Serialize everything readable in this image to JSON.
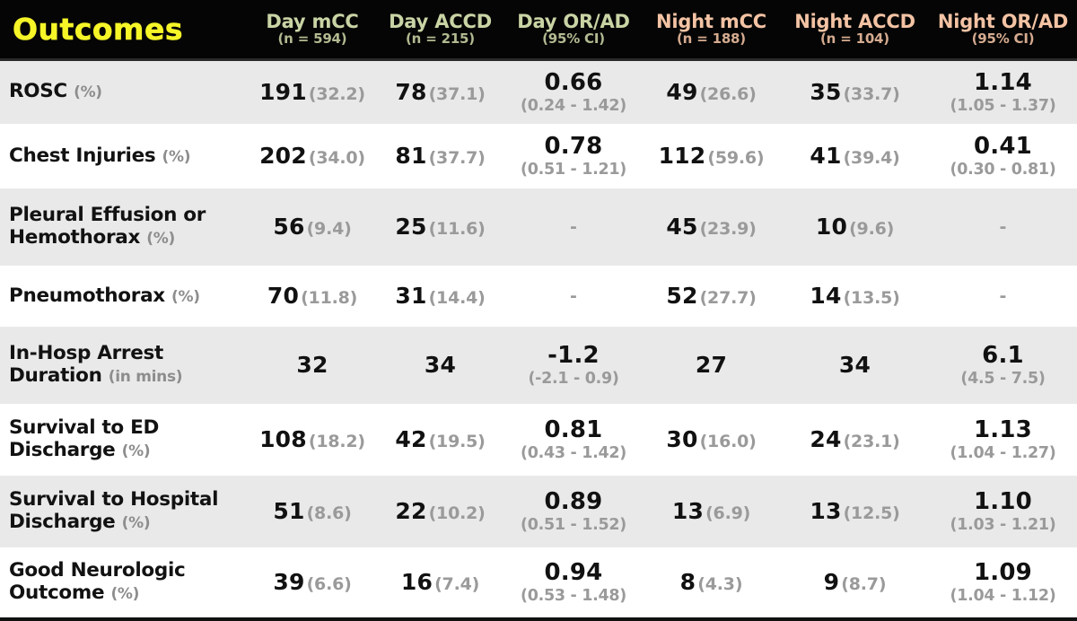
{
  "table": {
    "columns": [
      {
        "key": "outcome",
        "title": "Outcomes",
        "subtitle": "",
        "group": "title"
      },
      {
        "key": "day_mcc",
        "title": "Day mCC",
        "subtitle": "(n = 594)",
        "group": "day"
      },
      {
        "key": "day_accd",
        "title": "Day ACCD",
        "subtitle": "(n = 215)",
        "group": "day"
      },
      {
        "key": "day_orad",
        "title": "Day OR/AD",
        "subtitle": "(95% CI)",
        "group": "day"
      },
      {
        "key": "night_mcc",
        "title": "Night mCC",
        "subtitle": "(n = 188)",
        "group": "night"
      },
      {
        "key": "night_accd",
        "title": "Night ACCD",
        "subtitle": "(n = 104)",
        "group": "night"
      },
      {
        "key": "night_orad",
        "title": "Night OR/AD",
        "subtitle": "(95% CI)",
        "group": "night"
      }
    ],
    "rows": [
      {
        "label": "ROSC ",
        "unit": "(%)",
        "day_mcc": {
          "value": "191",
          "pct": "(32.2)"
        },
        "day_accd": {
          "value": "78",
          "pct": "(37.1)"
        },
        "day_orad": {
          "value": "0.66",
          "ci": "(0.24 - 1.42)"
        },
        "night_mcc": {
          "value": "49",
          "pct": "(26.6)"
        },
        "night_accd": {
          "value": "35",
          "pct": "(33.7)"
        },
        "night_orad": {
          "value": "1.14",
          "ci": "(1.05 - 1.37)"
        }
      },
      {
        "label": "Chest Injuries ",
        "unit": "(%)",
        "day_mcc": {
          "value": "202",
          "pct": "(34.0)"
        },
        "day_accd": {
          "value": "81",
          "pct": "(37.7)"
        },
        "day_orad": {
          "value": "0.78",
          "ci": "(0.51 - 1.21)"
        },
        "night_mcc": {
          "value": "112",
          "pct": "(59.6)"
        },
        "night_accd": {
          "value": "41",
          "pct": "(39.4)"
        },
        "night_orad": {
          "value": "0.41",
          "ci": "(0.30 - 0.81)"
        }
      },
      {
        "label": "Pleural Effusion or\nHemothorax ",
        "unit": "(%)",
        "day_mcc": {
          "value": "56",
          "pct": "(9.4)"
        },
        "day_accd": {
          "value": "25",
          "pct": "(11.6)"
        },
        "day_orad": {
          "value": "-",
          "ci": ""
        },
        "night_mcc": {
          "value": "45",
          "pct": "(23.9)"
        },
        "night_accd": {
          "value": "10",
          "pct": "(9.6)"
        },
        "night_orad": {
          "value": "-",
          "ci": ""
        }
      },
      {
        "label": "Pneumothorax ",
        "unit": "(%)",
        "day_mcc": {
          "value": "70",
          "pct": "(11.8)"
        },
        "day_accd": {
          "value": "31",
          "pct": "(14.4)"
        },
        "day_orad": {
          "value": "-",
          "ci": ""
        },
        "night_mcc": {
          "value": "52",
          "pct": "(27.7)"
        },
        "night_accd": {
          "value": "14",
          "pct": "(13.5)"
        },
        "night_orad": {
          "value": "-",
          "ci": ""
        }
      },
      {
        "label": "In-Hosp Arrest\nDuration ",
        "unit": "(in mins)",
        "day_mcc": {
          "value": "32",
          "pct": ""
        },
        "day_accd": {
          "value": "34",
          "pct": ""
        },
        "day_orad": {
          "value": "-1.2",
          "ci": "(-2.1 - 0.9)"
        },
        "night_mcc": {
          "value": "27",
          "pct": ""
        },
        "night_accd": {
          "value": "34",
          "pct": ""
        },
        "night_orad": {
          "value": "6.1",
          "ci": "(4.5 - 7.5)"
        }
      },
      {
        "label": "Survival to ED\nDischarge ",
        "unit": "(%)",
        "day_mcc": {
          "value": "108",
          "pct": "(18.2)"
        },
        "day_accd": {
          "value": "42",
          "pct": "(19.5)"
        },
        "day_orad": {
          "value": "0.81",
          "ci": "(0.43 - 1.42)"
        },
        "night_mcc": {
          "value": "30",
          "pct": "(16.0)"
        },
        "night_accd": {
          "value": "24",
          "pct": "(23.1)"
        },
        "night_orad": {
          "value": "1.13",
          "ci": "(1.04 - 1.27)"
        }
      },
      {
        "label": "Survival to Hospital\nDischarge ",
        "unit": "(%)",
        "day_mcc": {
          "value": "51",
          "pct": "(8.6)"
        },
        "day_accd": {
          "value": "22",
          "pct": "(10.2)"
        },
        "day_orad": {
          "value": "0.89",
          "ci": "(0.51 - 1.52)"
        },
        "night_mcc": {
          "value": "13",
          "pct": "(6.9)"
        },
        "night_accd": {
          "value": "13",
          "pct": "(12.5)"
        },
        "night_orad": {
          "value": "1.10",
          "ci": "(1.03 - 1.21)"
        }
      },
      {
        "label": "Good Neurologic\nOutcome ",
        "unit": "(%)",
        "day_mcc": {
          "value": "39",
          "pct": "(6.6)"
        },
        "day_accd": {
          "value": "16",
          "pct": "(7.4)"
        },
        "day_orad": {
          "value": "0.94",
          "ci": "(0.53 - 1.48)"
        },
        "night_mcc": {
          "value": "8",
          "pct": "(4.3)"
        },
        "night_accd": {
          "value": "9",
          "pct": "(8.7)"
        },
        "night_orad": {
          "value": "1.09",
          "ci": "(1.04 - 1.12)"
        }
      }
    ]
  },
  "colors": {
    "header_background": "#050505",
    "title_text": "#f5f528",
    "day_header_text": "#c9d4a5",
    "night_header_text": "#f3c3a4",
    "row_stripe": "#e9e9e9",
    "row_plain": "#ffffff",
    "value_text": "#111111",
    "secondary_text": "#9a9a9a"
  }
}
